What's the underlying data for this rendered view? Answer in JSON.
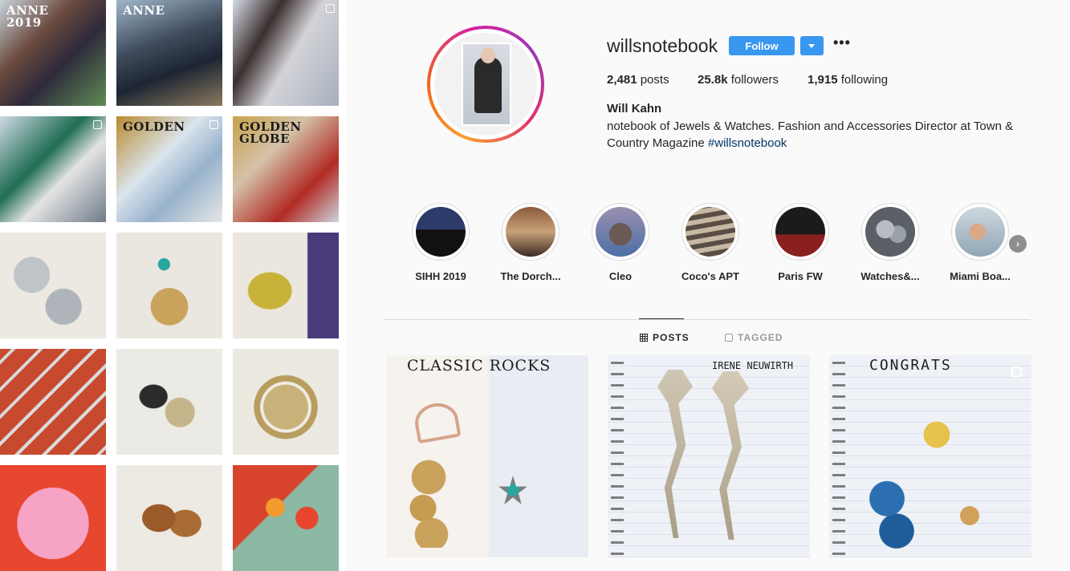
{
  "left_grid": {
    "tiles": [
      {
        "tag": "ANNE 2019",
        "dark": false
      },
      {
        "tag": "ANNE",
        "dark": false
      },
      {
        "tag": "",
        "dark": true
      },
      {
        "tag": "",
        "dark": true
      },
      {
        "tag": "GOLDEN",
        "dark": false
      },
      {
        "tag": "GOLDEN GLOBE",
        "dark": false
      },
      {
        "tag": "",
        "dark": true
      },
      {
        "tag": "",
        "dark": true
      },
      {
        "tag": "",
        "dark": true
      },
      {
        "tag": "",
        "dark": true
      },
      {
        "tag": "",
        "dark": true
      },
      {
        "tag": "",
        "dark": true
      },
      {
        "tag": "",
        "dark": true
      },
      {
        "tag": "",
        "dark": true
      },
      {
        "tag": "",
        "dark": true
      }
    ]
  },
  "profile": {
    "username": "willsnotebook",
    "follow_label": "Follow",
    "more_label": "•••",
    "posts_count": "2,481",
    "posts_word": "posts",
    "followers_count": "25.8k",
    "followers_word": "followers",
    "following_count": "1,915",
    "following_word": "following",
    "full_name": "Will Kahn",
    "bio_text": "notebook of Jewels & Watches. Fashion and Accessories Director at Town & Country Magazine ",
    "bio_hashtag": "#willsnotebook"
  },
  "highlights": [
    {
      "label": "SIHH 2019"
    },
    {
      "label": "The Dorch..."
    },
    {
      "label": "Cleo"
    },
    {
      "label": "Coco's APT"
    },
    {
      "label": "Paris FW"
    },
    {
      "label": "Watches&..."
    },
    {
      "label": "Miami Boa..."
    }
  ],
  "tabs": {
    "posts": "POSTS",
    "tagged": "TAGGED"
  },
  "posts": [
    {
      "title": "CLASSIC ROCKS"
    },
    {
      "title": "IRENE NEUWIRTH"
    },
    {
      "title": "CONGRATS"
    }
  ],
  "colors": {
    "accent": "#3897f0",
    "hashtag": "#003569"
  },
  "icons": {
    "more": "ellipsis-icon",
    "dropdown": "caret-down-icon",
    "next": "chevron-right-icon",
    "posts_tab": "grid-icon",
    "tagged_tab": "tag-icon",
    "multi": "multiple-photos-icon"
  }
}
